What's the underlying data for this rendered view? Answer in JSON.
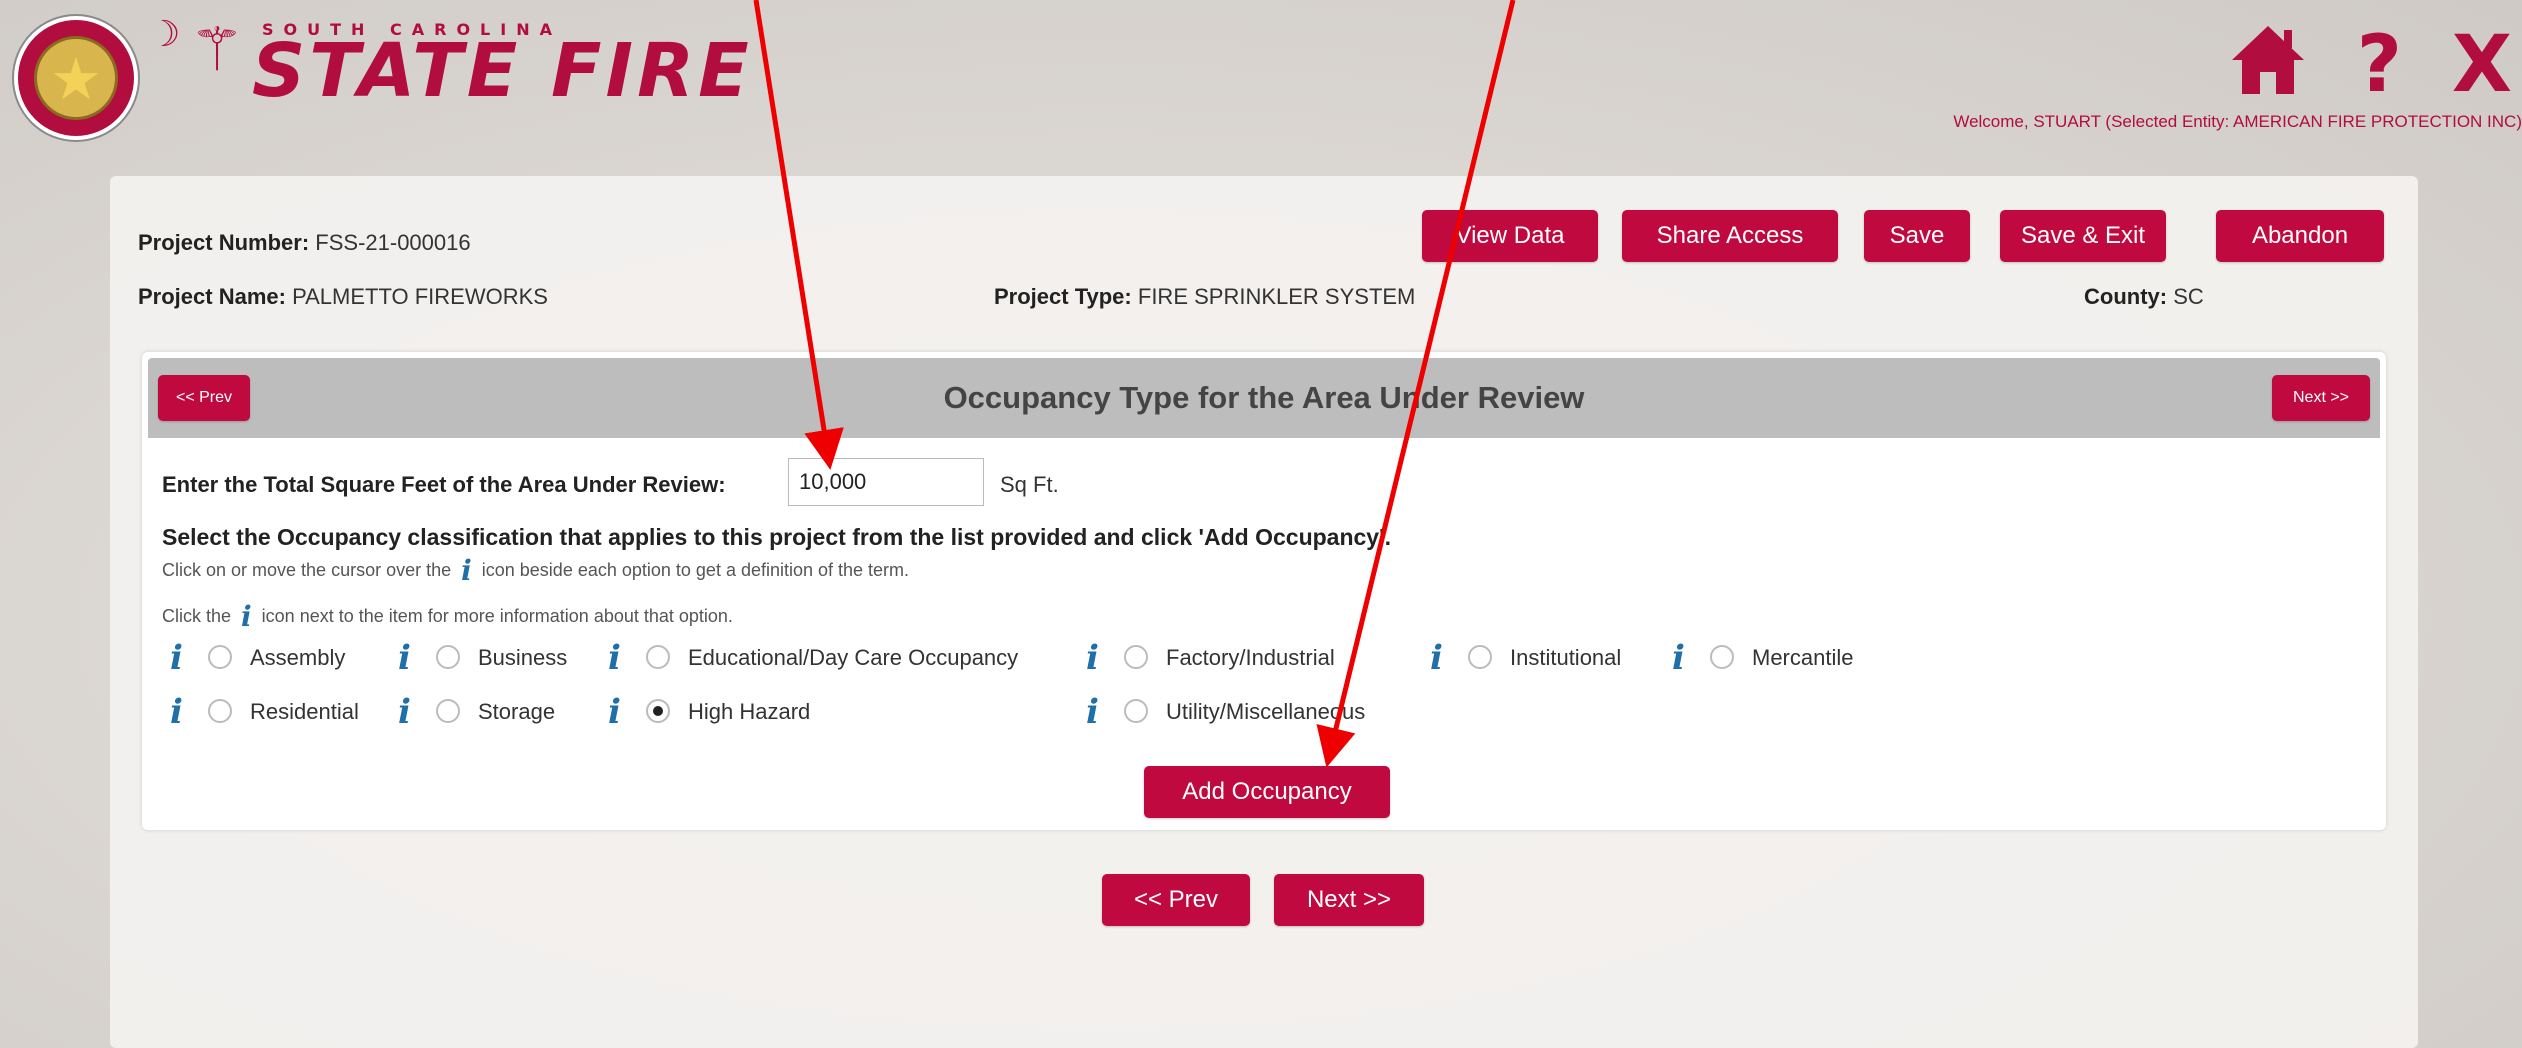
{
  "header": {
    "state_small": "SOUTH CAROLINA",
    "brand": "STATE FIRE",
    "seal_text": "STATE FIRE",
    "welcome": "Welcome, STUART (Selected Entity: AMERICAN FIRE PROTECTION INC)",
    "help_glyph": "?",
    "close_glyph": "X"
  },
  "project": {
    "number_label": "Project Number:",
    "number_value": "FSS-21-000016",
    "name_label": "Project Name:",
    "name_value": "PALMETTO FIREWORKS",
    "type_label": "Project Type:",
    "type_value": "FIRE SPRINKLER SYSTEM",
    "county_label": "County:",
    "county_value": "SC"
  },
  "toolbar": {
    "view_data": "View Data",
    "share_access": "Share Access",
    "save": "Save",
    "save_exit": "Save & Exit",
    "abandon": "Abandon"
  },
  "section": {
    "title": "Occupancy Type for the Area Under Review",
    "prev_small": "<< Prev",
    "next_small": "Next >>",
    "sqft_label": "Enter the Total Square Feet of the Area Under Review:",
    "sqft_value": "10,000",
    "sqft_unit": "Sq Ft.",
    "instruction_main": "Select the Occupancy classification that applies to this project from the list provided and click 'Add Occupancy'.",
    "instruction_hover_pre": "Click on or move the cursor over the",
    "instruction_hover_post": "icon beside each option to get a definition of the term.",
    "instruction_click_pre": "Click the",
    "instruction_click_post": "icon next to the item for more information about that option.",
    "info_glyph": "i",
    "options": [
      {
        "label": "Assembly",
        "checked": false
      },
      {
        "label": "Business",
        "checked": false
      },
      {
        "label": "Educational/Day Care Occupancy",
        "checked": false
      },
      {
        "label": "Factory/Industrial",
        "checked": false
      },
      {
        "label": "Institutional",
        "checked": false
      },
      {
        "label": "Mercantile",
        "checked": false
      },
      {
        "label": "Residential",
        "checked": false
      },
      {
        "label": "Storage",
        "checked": false
      },
      {
        "label": "High Hazard",
        "checked": true
      },
      {
        "label": "Utility/Miscellaneous",
        "checked": false
      }
    ],
    "add_occupancy": "Add Occupancy"
  },
  "footer_nav": {
    "prev": "<< Prev",
    "next": "Next >>"
  },
  "colors": {
    "brand_red": "#c0093f",
    "info_blue": "#1f6fa8",
    "annotation_red": "#ee0000"
  }
}
